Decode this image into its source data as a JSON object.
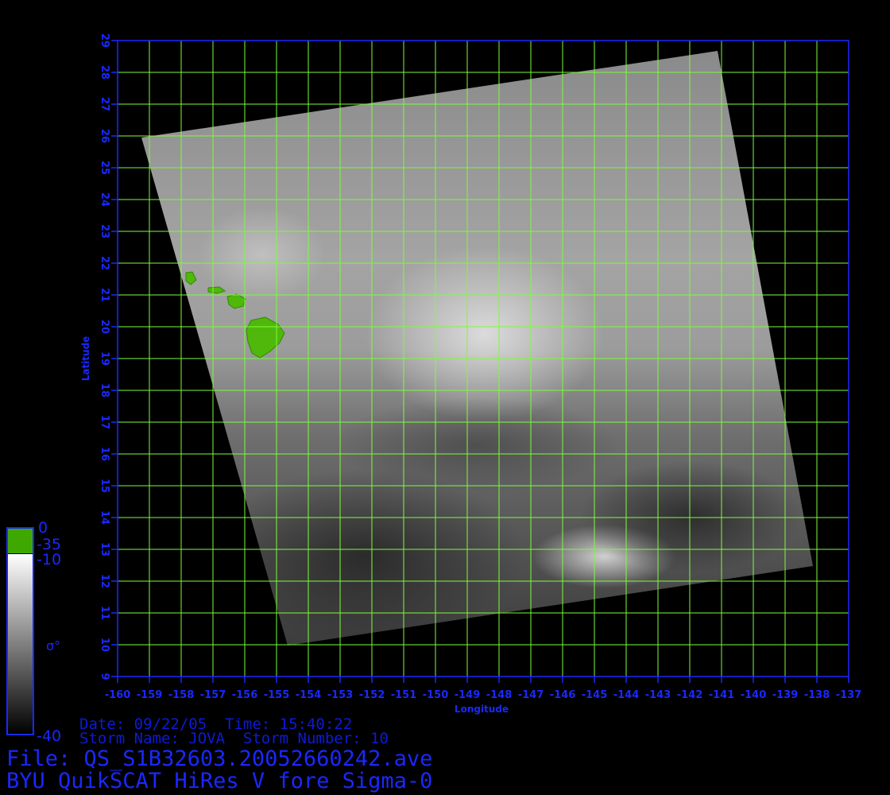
{
  "map": {
    "x_axis_title": "Longitude",
    "y_axis_title": "Latitude",
    "lon_range": [
      -160,
      -137
    ],
    "lat_range": [
      9,
      29
    ],
    "lon_ticks": [
      "-160",
      "-159",
      "-158",
      "-157",
      "-156",
      "-155",
      "-154",
      "-153",
      "-152",
      "-151",
      "-150",
      "-149",
      "-148",
      "-147",
      "-146",
      "-145",
      "-144",
      "-143",
      "-142",
      "-141",
      "-140",
      "-139",
      "-138",
      "-137"
    ],
    "lat_ticks": [
      "9",
      "10",
      "11",
      "12",
      "13",
      "14",
      "15",
      "16",
      "17",
      "18",
      "19",
      "20",
      "21",
      "22",
      "23",
      "24",
      "25",
      "26",
      "27",
      "28",
      "29"
    ],
    "grid_color": "#7cfc3a",
    "axis_color": "#1a28ff",
    "land_color": "#4fb80a"
  },
  "legend": {
    "top_value": "0",
    "land_threshold": "-35",
    "upper_value": "-10",
    "lower_value": "-40",
    "symbol": "σ°",
    "land_color": "#3fa800",
    "gradient_top": "#ffffff",
    "gradient_bottom": "#000000"
  },
  "info": {
    "date_line": "Date: 09/22/05  Time: 15:40:22",
    "storm_line": "Storm Name: JOVA  Storm Number: 10",
    "file_line": "File: QS_S1B32603.20052660242.ave",
    "product_line": "BYU QuikSCAT HiRes V fore Sigma-0"
  }
}
